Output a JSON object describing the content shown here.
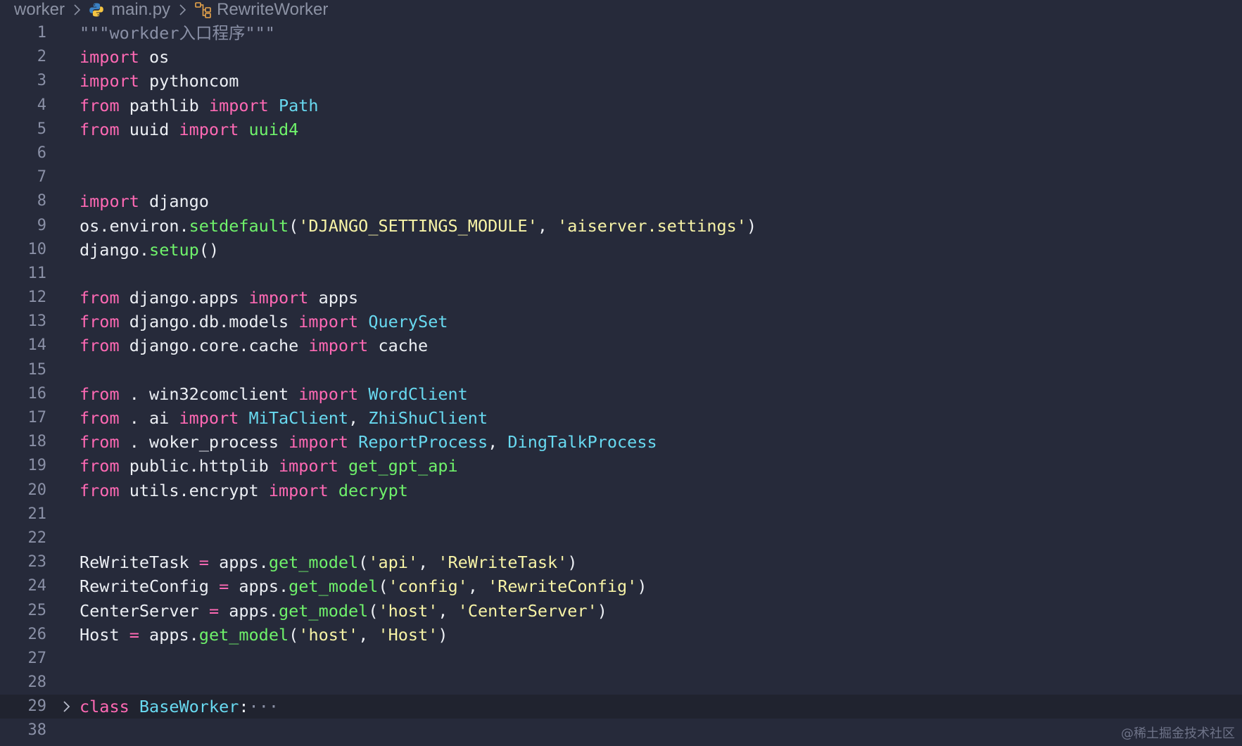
{
  "colors": {
    "background": "#262a3a",
    "keyword": "#ff69b4",
    "class_name": "#68d9f0",
    "function": "#6ff26b",
    "string": "#f7f3a6",
    "docstring": "#8a90a6",
    "plain": "#eceff4",
    "line_number": "#8a90a6",
    "python_icon_blue": "#3b82c4",
    "python_icon_yellow": "#f5c542",
    "symbol_icon": "#e8a54b"
  },
  "breadcrumb": {
    "folder": "worker",
    "file": "main.py",
    "file_icon": "python-icon",
    "symbol": "RewriteWorker",
    "symbol_icon": "class-symbol-icon",
    "separator_icon": "chevron-right-icon"
  },
  "editor": {
    "lines": [
      {
        "number": "1",
        "tokens": [
          [
            "\"\"\"workder入口程序\"\"\"",
            "docstring"
          ]
        ]
      },
      {
        "number": "2",
        "tokens": [
          [
            "import",
            "keyword"
          ],
          [
            " os",
            "plain"
          ]
        ]
      },
      {
        "number": "3",
        "tokens": [
          [
            "import",
            "keyword"
          ],
          [
            " pythoncom",
            "plain"
          ]
        ]
      },
      {
        "number": "4",
        "tokens": [
          [
            "from",
            "keyword"
          ],
          [
            " pathlib ",
            "plain"
          ],
          [
            "import",
            "keyword"
          ],
          [
            " ",
            "plain"
          ],
          [
            "Path",
            "class_name"
          ]
        ]
      },
      {
        "number": "5",
        "tokens": [
          [
            "from",
            "keyword"
          ],
          [
            " uuid ",
            "plain"
          ],
          [
            "import",
            "keyword"
          ],
          [
            " ",
            "plain"
          ],
          [
            "uuid4",
            "function"
          ]
        ]
      },
      {
        "number": "6",
        "tokens": []
      },
      {
        "number": "7",
        "tokens": []
      },
      {
        "number": "8",
        "tokens": [
          [
            "import",
            "keyword"
          ],
          [
            " django",
            "plain"
          ]
        ]
      },
      {
        "number": "9",
        "tokens": [
          [
            "os.environ.",
            "plain"
          ],
          [
            "setdefault",
            "function"
          ],
          [
            "(",
            "plain"
          ],
          [
            "'DJANGO_SETTINGS_MODULE'",
            "string"
          ],
          [
            ", ",
            "plain"
          ],
          [
            "'aiserver.settings'",
            "string"
          ],
          [
            ")",
            "plain"
          ]
        ]
      },
      {
        "number": "10",
        "tokens": [
          [
            "django.",
            "plain"
          ],
          [
            "setup",
            "function"
          ],
          [
            "()",
            "plain"
          ]
        ]
      },
      {
        "number": "11",
        "tokens": []
      },
      {
        "number": "12",
        "tokens": [
          [
            "from",
            "keyword"
          ],
          [
            " django.apps ",
            "plain"
          ],
          [
            "import",
            "keyword"
          ],
          [
            " apps",
            "plain"
          ]
        ]
      },
      {
        "number": "13",
        "tokens": [
          [
            "from",
            "keyword"
          ],
          [
            " django.db.models ",
            "plain"
          ],
          [
            "import",
            "keyword"
          ],
          [
            " ",
            "plain"
          ],
          [
            "QuerySet",
            "class_name"
          ]
        ]
      },
      {
        "number": "14",
        "tokens": [
          [
            "from",
            "keyword"
          ],
          [
            " django.core.cache ",
            "plain"
          ],
          [
            "import",
            "keyword"
          ],
          [
            " cache",
            "plain"
          ]
        ]
      },
      {
        "number": "15",
        "tokens": []
      },
      {
        "number": "16",
        "tokens": [
          [
            "from",
            "keyword"
          ],
          [
            " . win32comclient ",
            "plain"
          ],
          [
            "import",
            "keyword"
          ],
          [
            " ",
            "plain"
          ],
          [
            "WordClient",
            "class_name"
          ]
        ]
      },
      {
        "number": "17",
        "tokens": [
          [
            "from",
            "keyword"
          ],
          [
            " . ai ",
            "plain"
          ],
          [
            "import",
            "keyword"
          ],
          [
            " ",
            "plain"
          ],
          [
            "MiTaClient",
            "class_name"
          ],
          [
            ", ",
            "plain"
          ],
          [
            "ZhiShuClient",
            "class_name"
          ]
        ]
      },
      {
        "number": "18",
        "tokens": [
          [
            "from",
            "keyword"
          ],
          [
            " . woker_process ",
            "plain"
          ],
          [
            "import",
            "keyword"
          ],
          [
            " ",
            "plain"
          ],
          [
            "ReportProcess",
            "class_name"
          ],
          [
            ", ",
            "plain"
          ],
          [
            "DingTalkProcess",
            "class_name"
          ]
        ]
      },
      {
        "number": "19",
        "tokens": [
          [
            "from",
            "keyword"
          ],
          [
            " public.httplib ",
            "plain"
          ],
          [
            "import",
            "keyword"
          ],
          [
            " ",
            "plain"
          ],
          [
            "get_gpt_api",
            "function"
          ]
        ]
      },
      {
        "number": "20",
        "tokens": [
          [
            "from",
            "keyword"
          ],
          [
            " utils.encrypt ",
            "plain"
          ],
          [
            "import",
            "keyword"
          ],
          [
            " ",
            "plain"
          ],
          [
            "decrypt",
            "function"
          ]
        ]
      },
      {
        "number": "21",
        "tokens": []
      },
      {
        "number": "22",
        "tokens": []
      },
      {
        "number": "23",
        "tokens": [
          [
            "ReWriteTask ",
            "plain"
          ],
          [
            "=",
            "keyword"
          ],
          [
            " apps.",
            "plain"
          ],
          [
            "get_model",
            "function"
          ],
          [
            "(",
            "plain"
          ],
          [
            "'api'",
            "string"
          ],
          [
            ", ",
            "plain"
          ],
          [
            "'ReWriteTask'",
            "string"
          ],
          [
            ")",
            "plain"
          ]
        ]
      },
      {
        "number": "24",
        "tokens": [
          [
            "RewriteConfig ",
            "plain"
          ],
          [
            "=",
            "keyword"
          ],
          [
            " apps.",
            "plain"
          ],
          [
            "get_model",
            "function"
          ],
          [
            "(",
            "plain"
          ],
          [
            "'config'",
            "string"
          ],
          [
            ", ",
            "plain"
          ],
          [
            "'RewriteConfig'",
            "string"
          ],
          [
            ")",
            "plain"
          ]
        ]
      },
      {
        "number": "25",
        "tokens": [
          [
            "CenterServer ",
            "plain"
          ],
          [
            "=",
            "keyword"
          ],
          [
            " apps.",
            "plain"
          ],
          [
            "get_model",
            "function"
          ],
          [
            "(",
            "plain"
          ],
          [
            "'host'",
            "string"
          ],
          [
            ", ",
            "plain"
          ],
          [
            "'CenterServer'",
            "string"
          ],
          [
            ")",
            "plain"
          ]
        ]
      },
      {
        "number": "26",
        "tokens": [
          [
            "Host ",
            "plain"
          ],
          [
            "=",
            "keyword"
          ],
          [
            " apps.",
            "plain"
          ],
          [
            "get_model",
            "function"
          ],
          [
            "(",
            "plain"
          ],
          [
            "'host'",
            "string"
          ],
          [
            ", ",
            "plain"
          ],
          [
            "'Host'",
            "string"
          ],
          [
            ")",
            "plain"
          ]
        ]
      },
      {
        "number": "27",
        "tokens": []
      },
      {
        "number": "28",
        "tokens": []
      },
      {
        "number": "29",
        "tokens": [
          [
            "class",
            "keyword"
          ],
          [
            " ",
            "plain"
          ],
          [
            "BaseWorker",
            "class_name"
          ],
          [
            ":",
            "plain"
          ]
        ],
        "folded": true,
        "fold_ellipsis": "···"
      },
      {
        "number": "38",
        "tokens": []
      }
    ]
  },
  "watermark": "@稀土掘金技术社区"
}
